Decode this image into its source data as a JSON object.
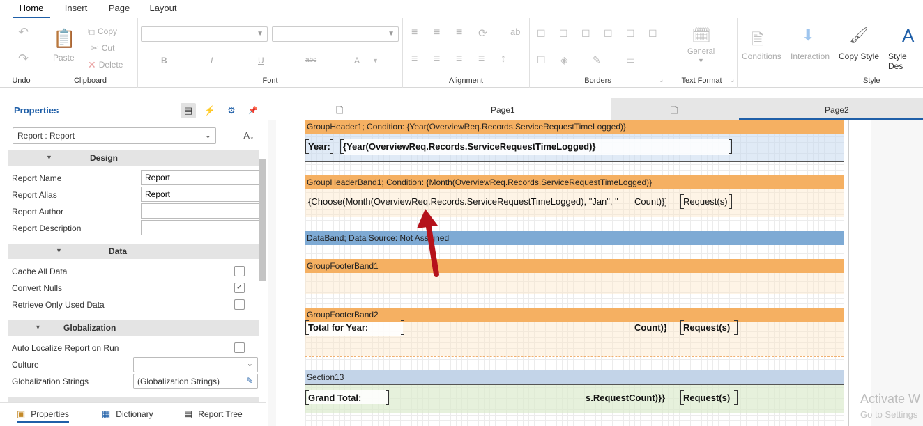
{
  "ribbon": {
    "tabs": [
      "Home",
      "Insert",
      "Page",
      "Layout"
    ],
    "undo": {
      "label": "Undo"
    },
    "clipboard": {
      "label": "Clipboard",
      "paste": "Paste",
      "copy": "Copy",
      "cut": "Cut",
      "delete": "Delete"
    },
    "font": {
      "label": "Font",
      "bold": "B",
      "italic": "I",
      "underline": "U",
      "strike": "abc",
      "color": "A"
    },
    "alignment": {
      "label": "Alignment"
    },
    "borders": {
      "label": "Borders"
    },
    "text_format": {
      "label": "Text Format",
      "general": "General"
    },
    "style": {
      "label": "Style",
      "conditions": "Conditions",
      "interaction": "Interaction",
      "copy_style": "Copy Style",
      "style_designer": "Style Des"
    }
  },
  "properties": {
    "title": "Properties",
    "selector": "Report : Report",
    "design": {
      "label": "Design",
      "report_name": {
        "label": "Report Name",
        "value": "Report"
      },
      "report_alias": {
        "label": "Report Alias",
        "value": "Report"
      },
      "report_author": {
        "label": "Report Author",
        "value": ""
      },
      "report_description": {
        "label": "Report Description",
        "value": ""
      }
    },
    "data": {
      "label": "Data",
      "cache_all_data": {
        "label": "Cache All Data",
        "checked": false
      },
      "convert_nulls": {
        "label": "Convert Nulls",
        "checked": true
      },
      "retrieve_only_used_data": {
        "label": "Retrieve Only Used Data",
        "checked": false
      }
    },
    "globalization": {
      "label": "Globalization",
      "auto_localize": {
        "label": "Auto Localize Report on Run",
        "checked": false
      },
      "culture": {
        "label": "Culture",
        "value": ""
      },
      "strings": {
        "label": "Globalization Strings",
        "value": "(Globalization Strings)"
      }
    },
    "bottom_tabs": [
      "Properties",
      "Dictionary",
      "Report Tree"
    ]
  },
  "pages": [
    "Page1",
    "Page2"
  ],
  "report": {
    "group_header1": "GroupHeader1; Condition: {Year(OverviewReq.Records.ServiceRequestTimeLogged)}",
    "year_label": "Year:",
    "year_expr": "{Year(OverviewReq.Records.ServiceRequestTimeLogged)}",
    "group_header_band1": "GroupHeaderBand1; Condition: {Month(OverviewReq.Records.ServiceRequestTimeLogged)}",
    "month_expr": "{Choose(Month(OverviewReq.Records.ServiceRequestTimeLogged), \"Jan\", \"",
    "count_expr": "Count)}}",
    "requests_label": "Request(s)",
    "data_band": "DataBand; Data Source: Not Assigned",
    "group_footer_band1": "GroupFooterBand1",
    "group_footer_band2": "GroupFooterBand2",
    "total_for_year": "Total for Year:",
    "total_count_expr": "Count)}}",
    "total_requests_label": "Request(s)",
    "section13": "Section13",
    "grand_total": "Grand Total:",
    "grand_count_expr": "s.RequestCount)}}",
    "grand_requests_label": "Request(s)"
  },
  "colors": {
    "band_orange": "#f5b062",
    "band_blue": "#7eaad4",
    "band_section": "#c3d4e8",
    "accent": "#1f5fa8"
  },
  "watermark": {
    "line1": "Activate W",
    "line2": "Go to Settings"
  }
}
